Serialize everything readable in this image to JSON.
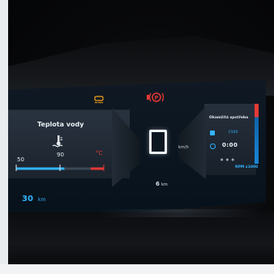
{
  "cluster": {
    "warning_icons": [
      "traction-control-icon",
      "parking-brake-icon"
    ],
    "left_panel": {
      "title": "Teplota vody",
      "icon": "coolant-thermometer-icon",
      "gauge_min_label": "50",
      "gauge_mid_label": "90",
      "gauge_unit": "°C",
      "gauge_level": 0.55
    },
    "range": {
      "value": "30",
      "unit": "km"
    },
    "center": {
      "gear": "",
      "speed_unit": "km/h",
      "distance_value": "6",
      "distance_unit": "km"
    },
    "right_panel": {
      "title": "Okamžitá spotřeba",
      "row1": "l/100",
      "row2": "0:00",
      "footer": "RPM x1000",
      "icons": [
        "fuel-pump-icon",
        "clock-icon"
      ]
    },
    "colors": {
      "accent": "#32b4ff",
      "warning_red": "#e53935",
      "warning_yellow": "#f2a21b",
      "text": "#e8edf2"
    }
  }
}
